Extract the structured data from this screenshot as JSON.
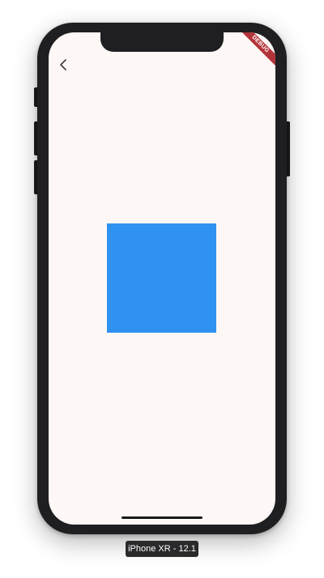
{
  "device": {
    "label": "iPhone XR - 12.1"
  },
  "app": {
    "debug_banner": "DEBUG",
    "back_icon": "chevron-left-icon",
    "box_color": "#2f92f1",
    "background_color": "#fdf8f6"
  }
}
